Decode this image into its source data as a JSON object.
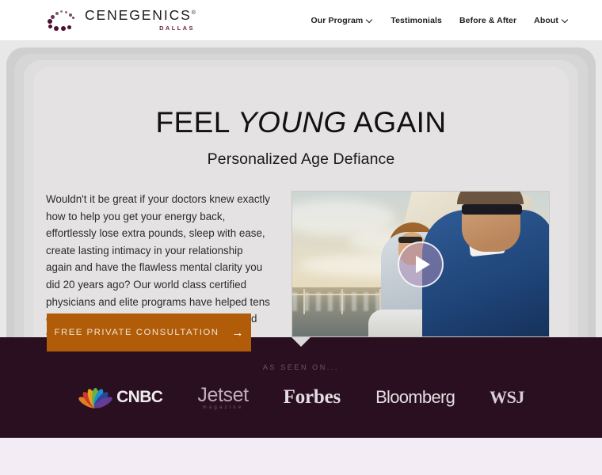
{
  "header": {
    "logo": {
      "name": "CENEGENICS",
      "registered": "®",
      "city": "DALLAS"
    },
    "nav": [
      {
        "label": "Our Program",
        "has_caret": true
      },
      {
        "label": "Testimonials",
        "has_caret": false
      },
      {
        "label": "Before & After",
        "has_caret": false
      },
      {
        "label": "About",
        "has_caret": true
      }
    ]
  },
  "hero": {
    "headline_pre": "FEEL ",
    "headline_em": "YOUNG",
    "headline_post": " AGAIN",
    "subhead": "Personalized Age Defiance",
    "body": "Wouldn't it be great if your doctors knew exactly how to help you get your energy back, effortlessly lose extra pounds, sleep with ease, create lasting intimacy in your relationship again and have the flawless mental clarity you did 20 years ago? Our world class certified physicians and elite programs have helped tens of thousands of busy people just like you find their best again.",
    "video": {
      "icon": "play-icon",
      "alt": "Couple sailing on a boat at sunset"
    },
    "cta": {
      "label": "FREE PRIVATE CONSULTATION",
      "arrow": "→"
    }
  },
  "press": {
    "label": "AS SEEN ON...",
    "logos": [
      {
        "name": "CNBC",
        "sub": ""
      },
      {
        "name": "Jetset",
        "sub": "magazine"
      },
      {
        "name": "Forbes",
        "sub": ""
      },
      {
        "name": "Bloomberg",
        "sub": ""
      },
      {
        "name": "WSJ",
        "sub": ""
      }
    ]
  },
  "colors": {
    "cta_orange": "#b05c08",
    "band_plum": "#2a0f20",
    "logo_maroon": "#6b2346",
    "page_lavender": "#f3ecf4",
    "hero_gray": "#e8e8e8"
  }
}
